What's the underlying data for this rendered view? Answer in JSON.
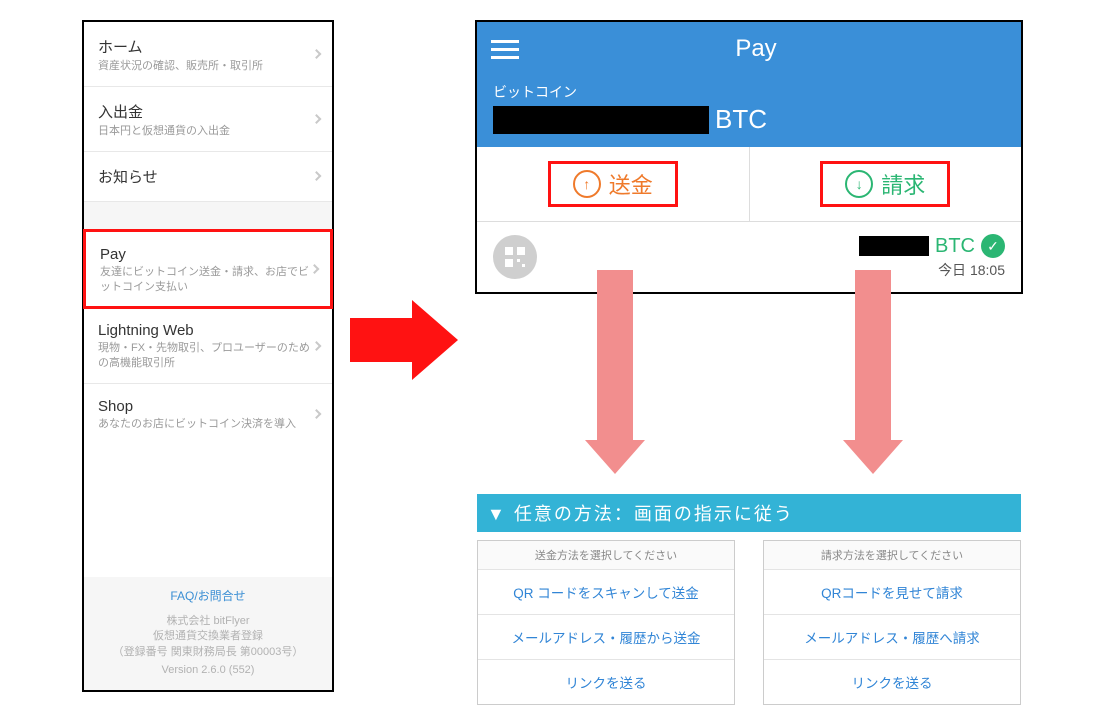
{
  "sidebar": {
    "items": [
      {
        "title": "ホーム",
        "subtitle": "資産状況の確認、販売所・取引所"
      },
      {
        "title": "入出金",
        "subtitle": "日本円と仮想通貨の入出金"
      },
      {
        "title": "お知らせ",
        "subtitle": ""
      },
      {
        "title": "Pay",
        "subtitle": "友達にビットコイン送金・請求、お店でビットコイン支払い"
      },
      {
        "title": "Lightning Web",
        "subtitle": "現物・FX・先物取引、プロユーザーのための高機能取引所"
      },
      {
        "title": "Shop",
        "subtitle": "あなたのお店にビットコイン決済を導入"
      }
    ],
    "faq_label": "FAQ/お問合せ",
    "corp_line1": "株式会社 bitFlyer",
    "corp_line2": "仮想通貨交換業者登録",
    "corp_line3": "（登録番号 関東財務局長 第00003号）",
    "version": "Version 2.6.0 (552)"
  },
  "pay": {
    "title": "Pay",
    "balance_label": "ビットコイン",
    "balance_currency": "BTC",
    "send_label": "送金",
    "recv_label": "請求",
    "tx_currency": "BTC",
    "tx_time": "今日 18:05"
  },
  "blue_bar": "▼ 任意の方法：画面の指示に従う",
  "send_options": {
    "header": "送金方法を選択してください",
    "items": [
      "QR コードをスキャンして送金",
      "メールアドレス・履歴から送金",
      "リンクを送る"
    ]
  },
  "recv_options": {
    "header": "請求方法を選択してください",
    "items": [
      "QRコードを見せて請求",
      "メールアドレス・履歴へ請求",
      "リンクを送る"
    ]
  }
}
